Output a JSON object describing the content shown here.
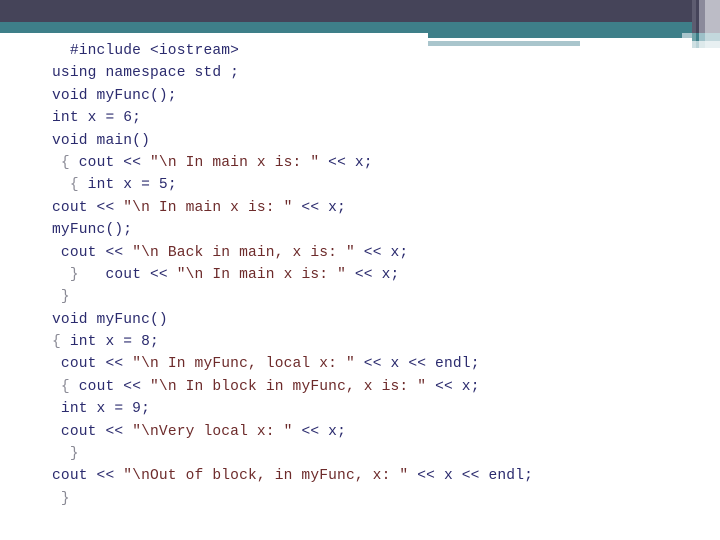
{
  "slide": {
    "theme_colors": {
      "navy": "#454459",
      "teal": "#3e7f89",
      "light_blue": "#a9c5cc",
      "pale_blue": "#c3d8dd",
      "white": "#ffffff",
      "code_text": "#2b2b6e",
      "string_text": "#6d2b2b",
      "brace_text": "#8a8a95"
    }
  },
  "code": {
    "language": "cpp",
    "lines": [
      {
        "indent": "  ",
        "tokens": [
          {
            "t": "#include <iostream>",
            "c": "code"
          }
        ]
      },
      {
        "indent": "",
        "tokens": [
          {
            "t": "using namespace std ;",
            "c": "code"
          }
        ]
      },
      {
        "indent": "",
        "tokens": [
          {
            "t": "void myFunc();",
            "c": "code"
          }
        ]
      },
      {
        "indent": "",
        "tokens": [
          {
            "t": "int x = 6;",
            "c": "code"
          }
        ]
      },
      {
        "indent": "",
        "tokens": [
          {
            "t": "void main()",
            "c": "code"
          }
        ]
      },
      {
        "indent": " ",
        "tokens": [
          {
            "t": "{ ",
            "c": "brace"
          },
          {
            "t": "cout << ",
            "c": "code"
          },
          {
            "t": "\"\\n In main x is: \"",
            "c": "string"
          },
          {
            "t": " << x;",
            "c": "code"
          }
        ]
      },
      {
        "indent": "  ",
        "tokens": [
          {
            "t": "{ ",
            "c": "brace"
          },
          {
            "t": "int x = 5;",
            "c": "code"
          }
        ]
      },
      {
        "indent": "",
        "tokens": [
          {
            "t": "cout << ",
            "c": "code"
          },
          {
            "t": "\"\\n In main x is: \"",
            "c": "string"
          },
          {
            "t": " << x;",
            "c": "code"
          }
        ]
      },
      {
        "indent": "",
        "tokens": [
          {
            "t": "myFunc();",
            "c": "code"
          }
        ]
      },
      {
        "indent": " ",
        "tokens": [
          {
            "t": "cout << ",
            "c": "code"
          },
          {
            "t": "\"\\n Back in main, x is: \"",
            "c": "string"
          },
          {
            "t": " << x;",
            "c": "code"
          }
        ]
      },
      {
        "indent": "  ",
        "tokens": [
          {
            "t": "}",
            "c": "brace"
          },
          {
            "t": "   cout << ",
            "c": "code"
          },
          {
            "t": "\"\\n In main x is: \"",
            "c": "string"
          },
          {
            "t": " << x;",
            "c": "code"
          }
        ]
      },
      {
        "indent": " ",
        "tokens": [
          {
            "t": "}",
            "c": "brace"
          }
        ]
      },
      {
        "indent": "",
        "tokens": [
          {
            "t": "void myFunc()",
            "c": "code"
          }
        ]
      },
      {
        "indent": "",
        "tokens": [
          {
            "t": "{ ",
            "c": "brace"
          },
          {
            "t": "int x = 8;",
            "c": "code"
          }
        ]
      },
      {
        "indent": " ",
        "tokens": [
          {
            "t": "cout << ",
            "c": "code"
          },
          {
            "t": "\"\\n In myFunc, local x: \"",
            "c": "string"
          },
          {
            "t": " << x << endl;",
            "c": "code"
          }
        ]
      },
      {
        "indent": " ",
        "tokens": [
          {
            "t": "{ ",
            "c": "brace"
          },
          {
            "t": "cout << ",
            "c": "code"
          },
          {
            "t": "\"\\n In block in myFunc, x is: \"",
            "c": "string"
          },
          {
            "t": " << x;",
            "c": "code"
          }
        ]
      },
      {
        "indent": " ",
        "tokens": [
          {
            "t": "int x = 9;",
            "c": "code"
          }
        ]
      },
      {
        "indent": " ",
        "tokens": [
          {
            "t": "cout << ",
            "c": "code"
          },
          {
            "t": "\"\\nVery local x: \"",
            "c": "string"
          },
          {
            "t": " << x;",
            "c": "code"
          }
        ]
      },
      {
        "indent": "  ",
        "tokens": [
          {
            "t": "}",
            "c": "brace"
          }
        ]
      },
      {
        "indent": "",
        "tokens": [
          {
            "t": "cout << ",
            "c": "code"
          },
          {
            "t": "\"\\nOut of block, in myFunc, x: \"",
            "c": "string"
          },
          {
            "t": " << x << endl;",
            "c": "code"
          }
        ]
      },
      {
        "indent": " ",
        "tokens": [
          {
            "t": "}",
            "c": "brace"
          }
        ]
      }
    ]
  }
}
